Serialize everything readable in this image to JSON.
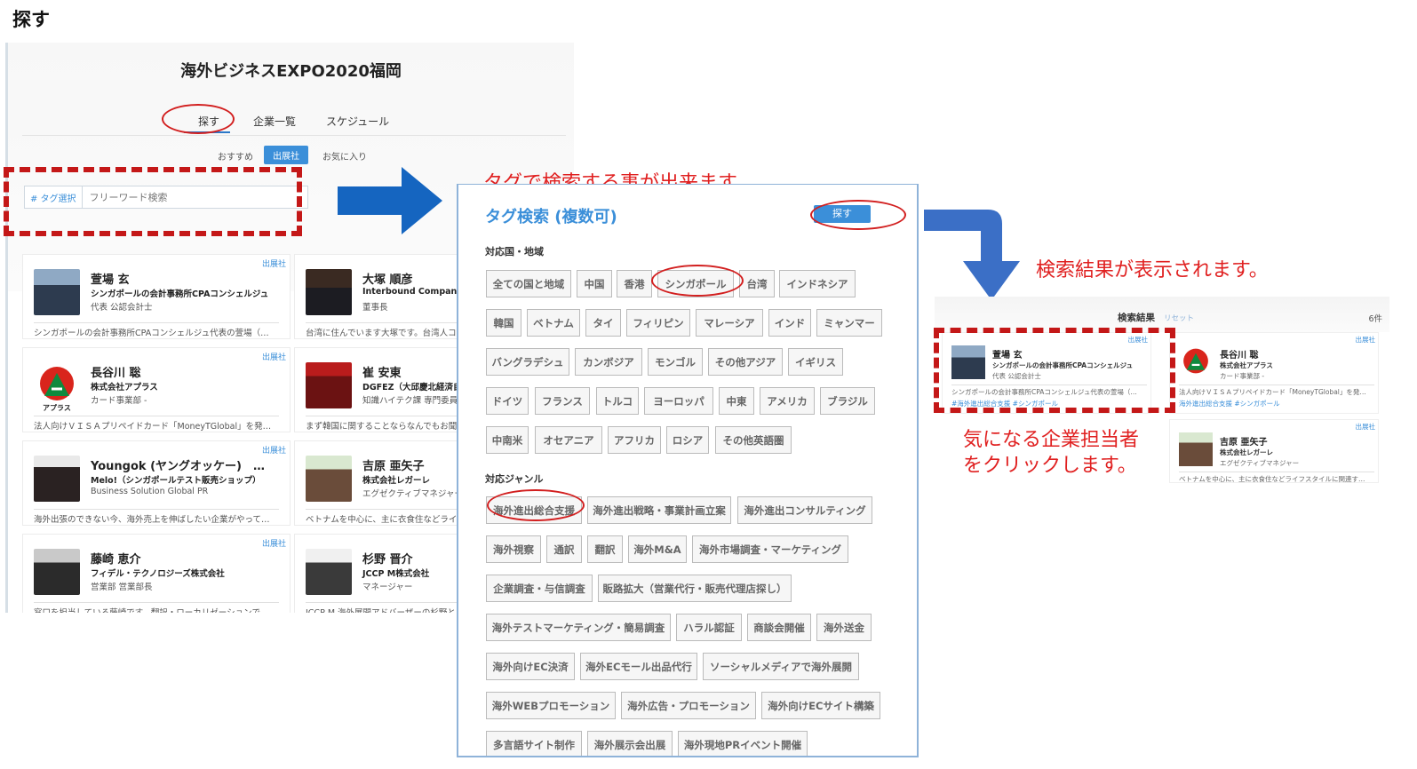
{
  "heading": "探す",
  "left": {
    "event_title": "海外ビジネスEXPO2020福岡",
    "tabs": [
      "探す",
      "企業一覧",
      "スケジュール"
    ],
    "subtabs": [
      "おすすめ",
      "出展社",
      "お気に入り"
    ],
    "tag_select": "# タグ選択",
    "search_placeholder": "フリーワード検索",
    "cards": [
      {
        "badge": "出展社",
        "name": "萱場 玄",
        "company": "シンガポールの会計事務所CPAコンシェルジュ",
        "role": "代表 公認会計士",
        "desc": "シンガポールの会計事務所CPAコンシェルジュ代表の萱場（…"
      },
      {
        "badge": "",
        "name": "大塚 順彦",
        "company": "Interbound Company",
        "role": "董事長",
        "desc": "台湾に住んでいます大塚です。台湾人コ"
      },
      {
        "badge": "出展社",
        "name": "長谷川 聡",
        "company": "株式会社アプラス",
        "role": "カード事業部 -",
        "desc": "法人向けＶＩＳＡプリペイドカード「MoneyTGlobal」を発…"
      },
      {
        "badge": "",
        "name": "崔 安東",
        "company": "DGFEZ（大邱慶北経済自",
        "role": "知識ハイテク課 専門委員",
        "desc": "まず韓国に関することならなんでもお聞"
      },
      {
        "badge": "出展社",
        "name": "Youngok (ヤングオッケー)　…",
        "company": "Melo!（シンガポールテスト販売ショップ）",
        "role": "Business Solution Global PR",
        "desc": "海外出張のできない今、海外売上を伸ばしたい企業がやって…"
      },
      {
        "badge": "",
        "name": "吉原 亜矢子",
        "company": "株式会社レガーレ",
        "role": "エグゼクティブマネジャー",
        "desc": "ベトナムを中心に、主に衣食住などライ"
      },
      {
        "badge": "出展社",
        "name": "藤崎 恵介",
        "company": "フィデル・テクノロジーズ株式会社",
        "role": "営業部 営業部長",
        "desc": "窓口を担当している藤崎です。翻訳・ローカリゼーションで…"
      },
      {
        "badge": "",
        "name": "杉野 晋介",
        "company": "JCCP M株式会社",
        "role": "マネージャー",
        "desc": "JCCP M 海外展開アドバーザーの杉野と"
      }
    ],
    "logo_text": "アプラス"
  },
  "tag_panel": {
    "caption": "タグで検索する事が出来ます。",
    "title": "タグ検索 (複数可)",
    "search_label": "探す",
    "region_label": "対応国・地域",
    "region_tags": [
      "全ての国と地域",
      "中国",
      "香港",
      "シンガポール",
      "台湾",
      "インドネシア",
      "韓国",
      "ベトナム",
      "タイ",
      "フィリピン",
      "マレーシア",
      "インド",
      "ミャンマー",
      "バングラデシュ",
      "カンボジア",
      "モンゴル",
      "その他アジア",
      "イギリス",
      "ドイツ",
      "フランス",
      "トルコ",
      "ヨーロッパ",
      "中東",
      "アメリカ",
      "ブラジル",
      "中南米",
      "オセアニア",
      "アフリカ",
      "ロシア",
      "その他英語圏"
    ],
    "genre_label": "対応ジャンル",
    "genre_tags": [
      "海外進出総合支援",
      "海外進出戦略・事業計画立案",
      "海外進出コンサルティング",
      "海外視察",
      "通訳",
      "翻訳",
      "海外M&A",
      "海外市場調査・マーケティング",
      "企業調査・与信調査",
      "販路拡大（営業代行・販売代理店探し）",
      "海外テストマーケティング・簡易調査",
      "ハラル認証",
      "商談会開催",
      "海外送金",
      "海外向けEC決済",
      "海外ECモール出品代行",
      "ソーシャルメディアで海外展開",
      "海外WEBプロモーション",
      "海外広告・プロモーション",
      "海外向けECサイト構築",
      "多言語サイト制作",
      "海外展示会出展",
      "海外現地PRイベント開催"
    ]
  },
  "results": {
    "caption": "検索結果が表示されます。",
    "title": "検索結果",
    "reset": "リセット",
    "count": "6件",
    "cards": [
      {
        "badge": "出展社",
        "name": "萱場 玄",
        "company": "シンガポールの会計事務所CPAコンシェルジュ",
        "role": "代表 公認会計士",
        "desc": "シンガポールの会計事務所CPAコンシェルジュ代表の萱場（…",
        "tags": "#海外進出総合支援 #シンガポール"
      },
      {
        "badge": "出展社",
        "name": "長谷川 聡",
        "company": "株式会社アプラス",
        "role": "カード事業部 -",
        "desc": "法人向けＶＩＳＡプリペイドカード「MoneyTGlobal」を発…",
        "tags": "海外進出総合支援 #シンガポール"
      },
      {
        "badge": "出展社",
        "name": "吉原 亜矢子",
        "company": "株式会社レガーレ",
        "role": "エグゼクティブマネジャー",
        "desc": "ベトナムを中心に、主に衣食住などライフスタイルに関連す…",
        "tags": ""
      }
    ],
    "click_caption_1": "気になる企業担当者",
    "click_caption_2": "をクリックします。"
  },
  "colors": {
    "accent": "#3b8fd9",
    "highlight_red": "#c41818",
    "arrow_blue": "#1565c0"
  }
}
